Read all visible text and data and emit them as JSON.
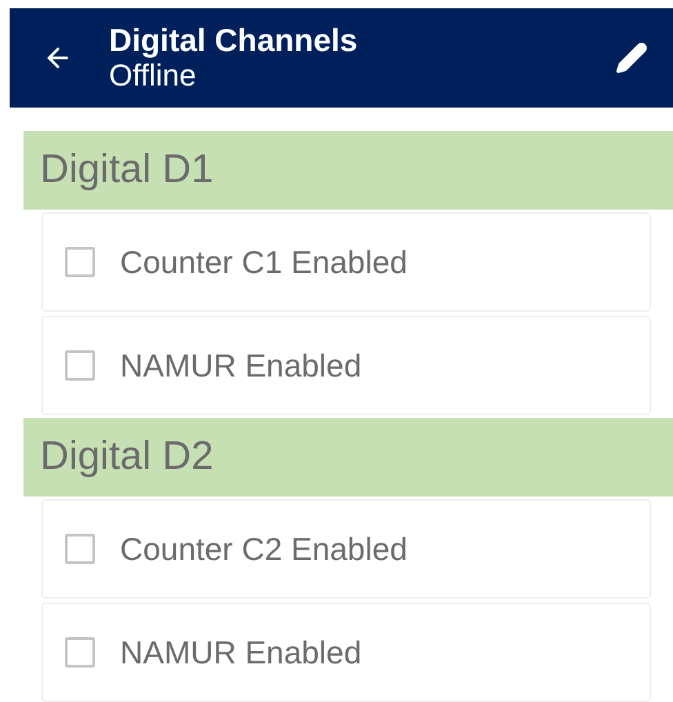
{
  "header": {
    "title": "Digital Channels",
    "subtitle": "Offline"
  },
  "sections": [
    {
      "title": "Digital D1",
      "items": [
        {
          "label": "Counter C1 Enabled",
          "checked": false
        },
        {
          "label": "NAMUR Enabled",
          "checked": false
        }
      ]
    },
    {
      "title": "Digital D2",
      "items": [
        {
          "label": "Counter C2 Enabled",
          "checked": false
        },
        {
          "label": "NAMUR Enabled",
          "checked": false
        }
      ]
    }
  ]
}
